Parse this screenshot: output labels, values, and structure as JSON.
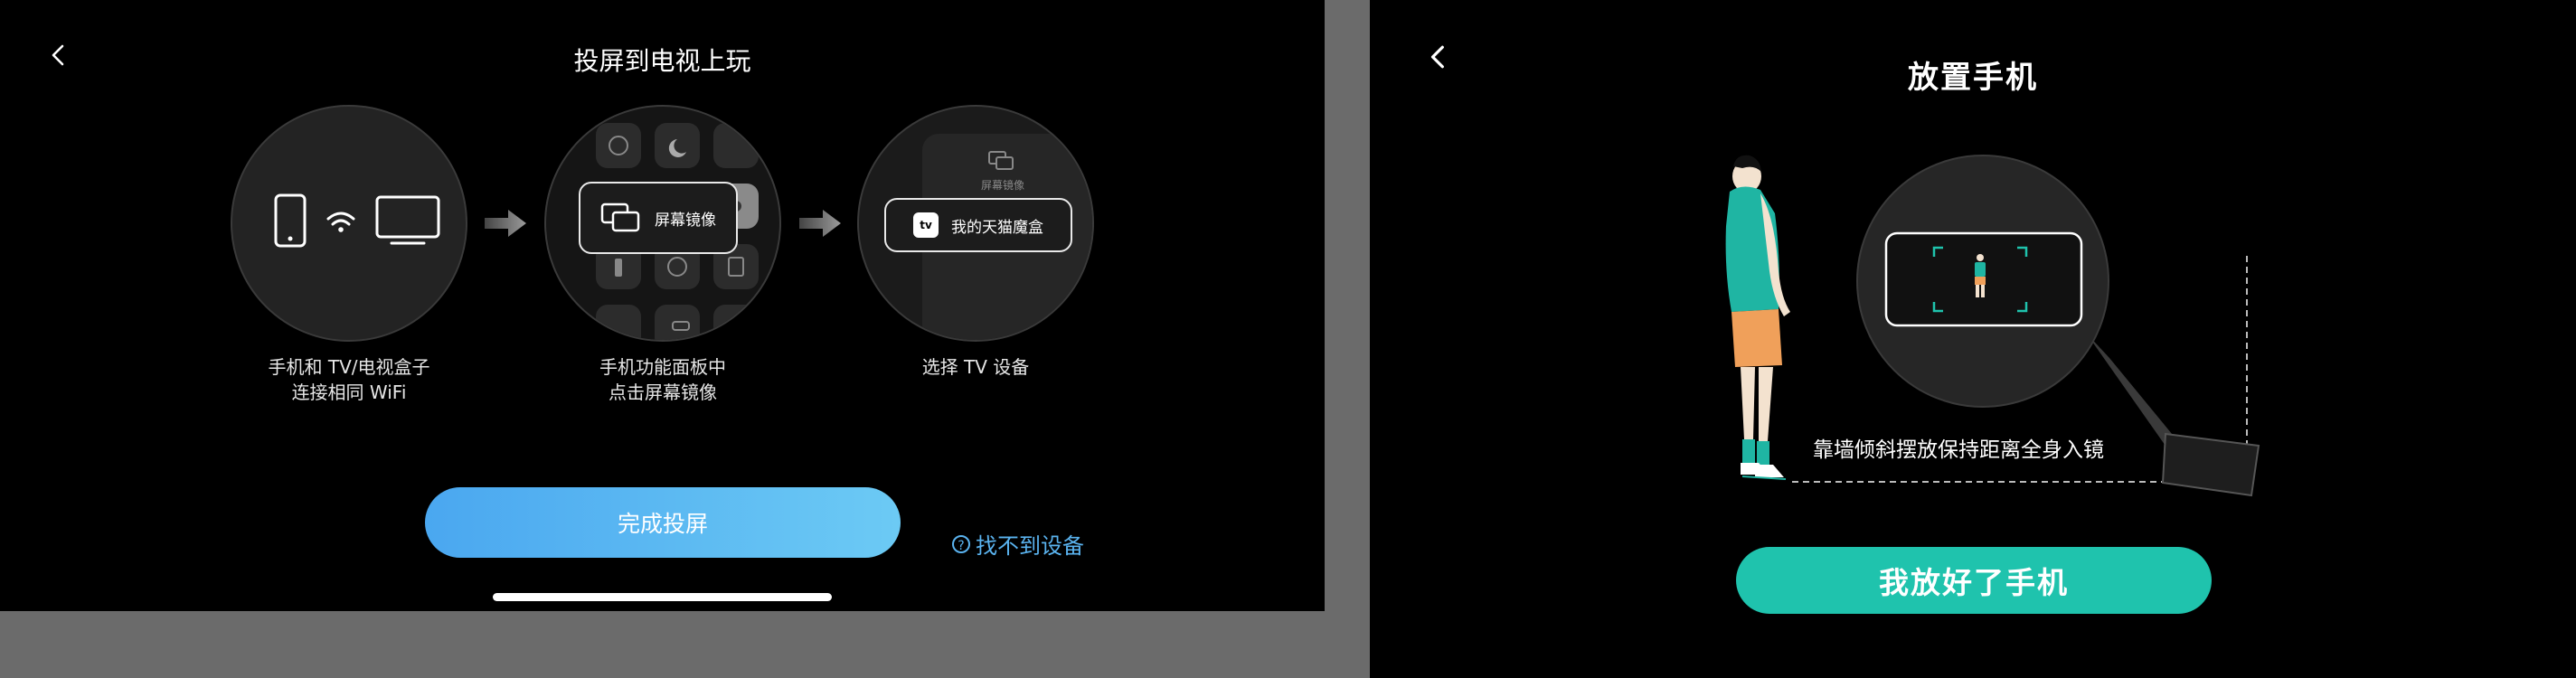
{
  "left_screen": {
    "title": "投屏到电视上玩",
    "steps": [
      {
        "line1": "手机和 TV/电视盒子",
        "line2": "连接相同 WiFi"
      },
      {
        "line1": "手机功能面板中",
        "line2": "点击屏幕镜像"
      },
      {
        "line1": "选择 TV 设备",
        "line2": ""
      }
    ],
    "mirror_popup_label": "屏幕镜像",
    "device_popup_label": "我的天猫魔盒",
    "device_badge": "tv",
    "step3_header_label": "屏幕镜像",
    "done_button": "完成投屏",
    "help_icon": "?",
    "help_link": "找不到设备"
  },
  "right_screen": {
    "title": "放置手机",
    "hint": "靠墙倾斜摆放保持距离全身入镜",
    "place_button": "我放好了手机"
  },
  "colors": {
    "done_gradient_start": "#4aa7f0",
    "done_gradient_end": "#6ccaf4",
    "help_link": "#5ab3ef",
    "place_button": "#1fc3ad",
    "shirt": "#1fb5a3",
    "shorts": "#f0a05a"
  },
  "icons": [
    "back-icon",
    "phone-icon",
    "wifi-icon",
    "tv-icon",
    "screen-mirror-icon",
    "arrow-right-icon",
    "question-icon",
    "apple-tv-icon"
  ]
}
